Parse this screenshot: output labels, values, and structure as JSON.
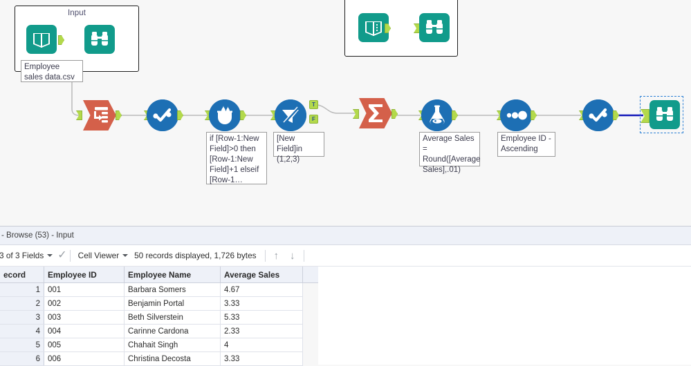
{
  "canvas": {
    "containers": [
      {
        "title": "Input",
        "nodes": [
          "book-input-icon",
          "binoculars-browse-icon"
        ]
      },
      {
        "title": "",
        "nodes": [
          "book-input-icon",
          "binoculars-browse-icon"
        ]
      }
    ],
    "annotations": [
      {
        "name": "input-file-label",
        "text": "Employee sales data.csv"
      },
      {
        "name": "multi-row-formula-expression",
        "text": "if [Row-1:New Field]>0 then [Row-1:New Field]+1 elseif [Row-1…"
      },
      {
        "name": "filter-expression",
        "text": "[New Field]in (1,2,3)"
      },
      {
        "name": "formula-expression",
        "text": "Average Sales = Round([Average Sales],.01)"
      },
      {
        "name": "sort-expression",
        "text": "Employee ID - Ascending"
      }
    ],
    "tools": [
      {
        "name": "input-data-tool",
        "icon": "input-data-icon",
        "color": "#d4604a"
      },
      {
        "name": "select-tool",
        "icon": "select-check-icon",
        "color": "#1d6fb4"
      },
      {
        "name": "multi-row-formula-tool",
        "icon": "multi-row-formula-icon",
        "color": "#1d6fb4"
      },
      {
        "name": "filter-tool",
        "icon": "filter-funnel-icon",
        "color": "#1d6fb4",
        "outputs": [
          "T",
          "F"
        ]
      },
      {
        "name": "summarize-tool",
        "icon": "sigma-icon",
        "color": "#d4604a"
      },
      {
        "name": "formula-tool",
        "icon": "flask-icon",
        "color": "#1d6fb4"
      },
      {
        "name": "sort-tool",
        "icon": "sort-dots-icon",
        "color": "#1d6fb4"
      },
      {
        "name": "select-tool-2",
        "icon": "select-check-icon",
        "color": "#1d6fb4"
      },
      {
        "name": "browse-tool",
        "icon": "binoculars-browse-icon",
        "color": "#119b8b",
        "selected": true
      }
    ],
    "colors": {
      "teal": "#119b8b",
      "blue": "#1d6fb4",
      "orange": "#d4604a",
      "anchor_green": "#b3d94b",
      "wire": "#b9b9b9",
      "selected_wire": "#1016b8",
      "selection_outline": "#2a7fd4",
      "canvas_bg": "#f7f7f7"
    }
  },
  "results": {
    "title": "- Browse (53) - Input",
    "toolbar": {
      "fields_label": "3 of 3 Fields",
      "view_label": "Cell Viewer",
      "status": "50 records displayed, 1,726 bytes",
      "up_arrow": "↑",
      "down_arrow": "↓",
      "check": "✓"
    },
    "table": {
      "columns": [
        "ecord",
        "Employee ID",
        "Employee Name",
        "Average Sales"
      ],
      "rows": [
        {
          "record": "1",
          "id": "001",
          "name": "Barbara Somers",
          "avg": "4.67"
        },
        {
          "record": "2",
          "id": "002",
          "name": "Benjamin Portal",
          "avg": "3.33"
        },
        {
          "record": "3",
          "id": "003",
          "name": "Beth Silverstein",
          "avg": "5.33"
        },
        {
          "record": "4",
          "id": "004",
          "name": "Carinne Cardona",
          "avg": "2.33"
        },
        {
          "record": "5",
          "id": "005",
          "name": "Chahait Singh",
          "avg": "4"
        },
        {
          "record": "6",
          "id": "006",
          "name": "Christina Decosta",
          "avg": "3.33"
        }
      ]
    }
  }
}
